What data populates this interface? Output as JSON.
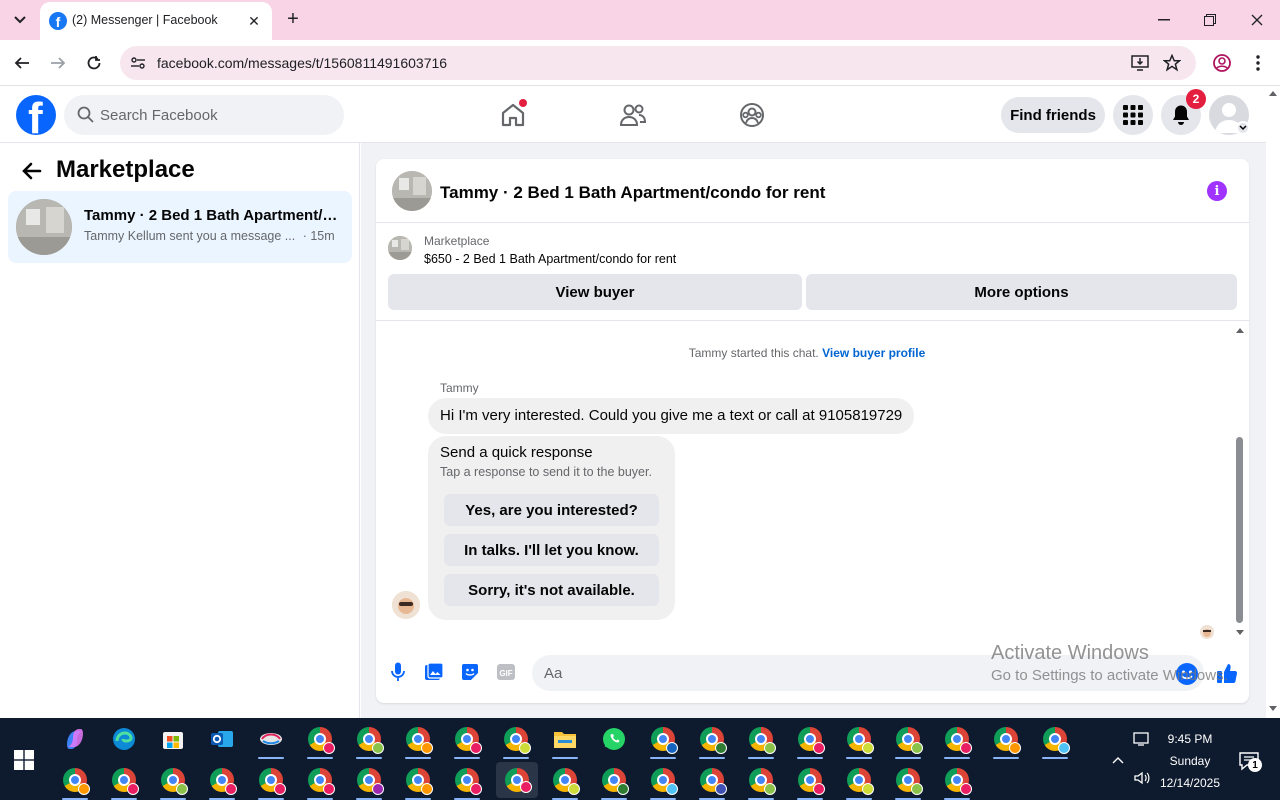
{
  "browser": {
    "tab_title": "(2) Messenger | Facebook",
    "url": "facebook.com/messages/t/1560811491603716"
  },
  "header": {
    "search_placeholder": "Search Facebook",
    "find_friends_label": "Find friends",
    "notification_count": "2"
  },
  "sidebar": {
    "title": "Marketplace",
    "conversations": [
      {
        "title": "Tammy · 2 Bed 1 Bath Apartment/condo for rent",
        "preview": "Tammy Kellum sent you a message ...",
        "time": "· 15m"
      }
    ]
  },
  "chat": {
    "title": "Tammy · 2 Bed 1 Bath Apartment/condo for rent",
    "listing": {
      "label": "Marketplace",
      "price_line": "$650 - 2 Bed 1 Bath Apartment/condo for rent"
    },
    "actions": {
      "view_buyer": "View buyer",
      "more_options": "More options"
    },
    "system_message": "Tammy started this chat.",
    "system_link": "View buyer profile",
    "sender_name": "Tammy",
    "message": "Hi I'm very interested. Could you give me a text or call at 9105819729",
    "quick_response": {
      "title": "Send a quick response",
      "subtitle": "Tap a response to send it to the buyer.",
      "options": [
        "Yes, are you interested?",
        "In talks. I'll let you know.",
        "Sorry, it's not available."
      ]
    },
    "composer_placeholder": "Aa"
  },
  "watermark": {
    "line1": "Activate Windows",
    "line2": "Go to Settings to activate Windows."
  },
  "taskbar": {
    "time": "9:45 PM",
    "day": "Sunday",
    "date": "12/14/2025",
    "notification_count": "1"
  },
  "colors": {
    "facebook_blue": "#0866ff",
    "link_blue": "#0064d1",
    "badge_red": "#e41e3f",
    "info_purple": "#a033ff",
    "tab_strip_pink": "#f9d3e6"
  }
}
